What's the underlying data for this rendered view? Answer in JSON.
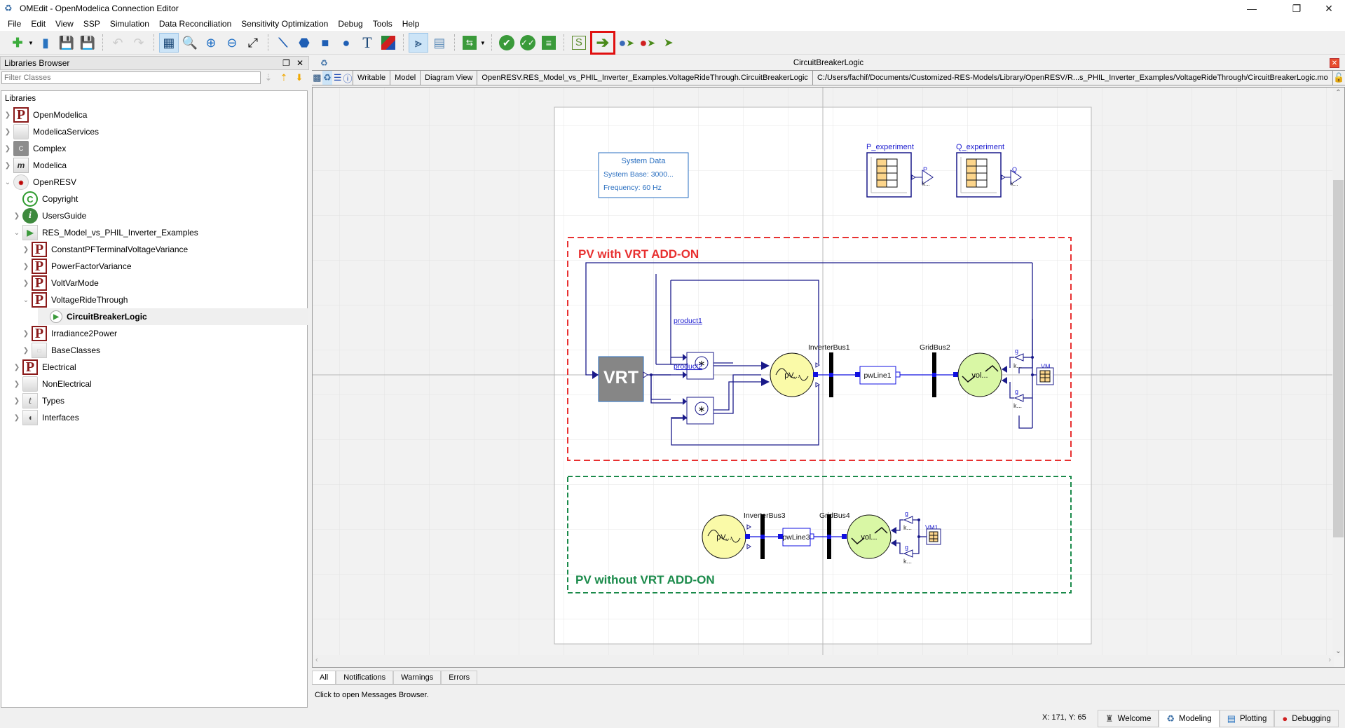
{
  "window": {
    "title": "OMEdit - OpenModelica Connection Editor",
    "controls": [
      "minimize",
      "restore",
      "close"
    ]
  },
  "menubar": {
    "items": [
      "File",
      "Edit",
      "View",
      "SSP",
      "Simulation",
      "Data Reconciliation",
      "Sensitivity Optimization",
      "Debug",
      "Tools",
      "Help"
    ]
  },
  "toolbar": {
    "buttons": [
      {
        "name": "new-model",
        "icon": "new-file-icon"
      },
      {
        "name": "open",
        "icon": "folder-icon"
      },
      {
        "name": "save",
        "icon": "save-icon"
      },
      {
        "name": "save-all",
        "icon": "save-all-icon"
      },
      {
        "name": "undo",
        "icon": "undo-icon"
      },
      {
        "name": "redo",
        "icon": "redo-icon"
      },
      {
        "name": "grid-lines",
        "icon": "grid-icon",
        "active": true
      },
      {
        "name": "reset-zoom",
        "icon": "zoom-icon"
      },
      {
        "name": "zoom-in",
        "icon": "zoom-in-icon"
      },
      {
        "name": "zoom-out",
        "icon": "zoom-out-icon"
      },
      {
        "name": "fit-to-diagram",
        "icon": "fit-icon"
      },
      {
        "name": "line",
        "icon": "line-icon"
      },
      {
        "name": "polygon",
        "icon": "polygon-icon"
      },
      {
        "name": "rectangle",
        "icon": "rectangle-icon"
      },
      {
        "name": "ellipse",
        "icon": "ellipse-icon"
      },
      {
        "name": "text",
        "icon": "text-icon"
      },
      {
        "name": "bitmap",
        "icon": "bitmap-icon"
      },
      {
        "name": "connect-mode",
        "icon": "connect-icon",
        "active": true
      },
      {
        "name": "transition-mode",
        "icon": "transition-icon"
      },
      {
        "name": "fmi",
        "icon": "exchange-icon"
      },
      {
        "name": "check-model",
        "icon": "check-icon"
      },
      {
        "name": "check-all",
        "icon": "check-all-icon"
      },
      {
        "name": "instantiate",
        "icon": "list-icon"
      },
      {
        "name": "simulation-setup",
        "icon": "s-icon"
      },
      {
        "name": "simulate",
        "icon": "simulate-arrow-icon",
        "highlighted": true
      },
      {
        "name": "simulate-algorithmic-debugger",
        "icon": "debug-blue-icon"
      },
      {
        "name": "simulate-transformational-debugger",
        "icon": "debug-red-icon"
      },
      {
        "name": "simulate-animation",
        "icon": "animation-icon"
      }
    ]
  },
  "libraries_browser": {
    "title": "Libraries Browser",
    "filter_placeholder": "Filter Classes",
    "tree_header": "Libraries",
    "items": [
      {
        "label": "OpenModelica",
        "icon": "P",
        "level": 0,
        "expanded": false
      },
      {
        "label": "ModelicaServices",
        "icon": "blank",
        "level": 0,
        "expanded": false
      },
      {
        "label": "Complex",
        "icon": "C",
        "level": 0,
        "expanded": false
      },
      {
        "label": "Modelica",
        "icon": "M",
        "level": 0,
        "expanded": false
      },
      {
        "label": "OpenRESV",
        "icon": "resv",
        "level": 0,
        "expanded": true
      },
      {
        "label": "Copyright",
        "icon": "copy",
        "level": 1,
        "leaf": true
      },
      {
        "label": "UsersGuide",
        "icon": "info",
        "level": 1,
        "expanded": false
      },
      {
        "label": "RES_Model_vs_PHIL_Inverter_Examples",
        "icon": "play",
        "level": 1,
        "expanded": true
      },
      {
        "label": "ConstantPFTerminalVoltageVariance",
        "icon": "P",
        "level": 2,
        "expanded": false
      },
      {
        "label": "PowerFactorVariance",
        "icon": "P",
        "level": 2,
        "expanded": false
      },
      {
        "label": "VoltVarMode",
        "icon": "P",
        "level": 2,
        "expanded": false
      },
      {
        "label": "VoltageRideThrough",
        "icon": "P",
        "level": 2,
        "expanded": true
      },
      {
        "label": "CircuitBreakerLogic",
        "icon": "playc",
        "level": 3,
        "leaf": true,
        "selected": true
      },
      {
        "label": "Irradiance2Power",
        "icon": "P",
        "level": 2,
        "expanded": false
      },
      {
        "label": "BaseClasses",
        "icon": "base",
        "level": 2,
        "expanded": false
      },
      {
        "label": "Electrical",
        "icon": "P",
        "level": 1,
        "expanded": false
      },
      {
        "label": "NonElectrical",
        "icon": "blank",
        "level": 1,
        "expanded": false
      },
      {
        "label": "Types",
        "icon": "types",
        "level": 1,
        "expanded": false
      },
      {
        "label": "Interfaces",
        "icon": "intf",
        "level": 1,
        "expanded": false
      }
    ]
  },
  "model_window": {
    "title": "CircuitBreakerLogic",
    "info_bar": {
      "access": "Writable",
      "restriction": "Model",
      "view": "Diagram View",
      "class_path": "OpenRESV.RES_Model_vs_PHIL_Inverter_Examples.VoltageRideThrough.CircuitBreakerLogic",
      "file_path": "C:/Users/fachif/Documents/Customized-RES-Models/Library/OpenRESV/R...s_PHIL_Inverter_Examples/VoltageRideThrough/CircuitBreakerLogic.mo"
    }
  },
  "diagram": {
    "system_data": {
      "title": "System Data",
      "line1": "System Base: 3000...",
      "line2": "Frequency: 60 Hz"
    },
    "tables": [
      {
        "label": "P_experiment",
        "out": "P",
        "gain": "k..."
      },
      {
        "label": "Q_experiment",
        "out": "Q",
        "gain": "k..."
      }
    ],
    "group_vrt": {
      "title": "PV with VRT ADD-ON",
      "color": "#e83030"
    },
    "group_novrt": {
      "title": "PV without VRT ADD-ON",
      "color": "#1a8a4a"
    },
    "vrt_block": "VRT",
    "product1": "product1",
    "product2": "product2",
    "pv": "pV...",
    "inverter_bus1": "InverterBus1",
    "pwline1": "pwLine1",
    "grid_bus2": "GridBus2",
    "vol": "vol...",
    "vm": "VM",
    "gain_top": "g",
    "gain_k": "k...",
    "inverter_bus3": "InverterBus3",
    "pwline3": "pwLine3",
    "grid_bus4": "GridBus4",
    "vm1": "VM1"
  },
  "messages": {
    "tabs": [
      "All",
      "Notifications",
      "Warnings",
      "Errors"
    ],
    "active_tab": "All",
    "hint": "Click to open Messages Browser."
  },
  "statusbar": {
    "coordinates": "X: 171, Y: 65",
    "perspectives": [
      {
        "label": "Welcome",
        "icon": "welcome-icon"
      },
      {
        "label": "Modeling",
        "icon": "modeling-icon",
        "active": true
      },
      {
        "label": "Plotting",
        "icon": "plotting-icon"
      },
      {
        "label": "Debugging",
        "icon": "debugging-icon"
      }
    ]
  }
}
